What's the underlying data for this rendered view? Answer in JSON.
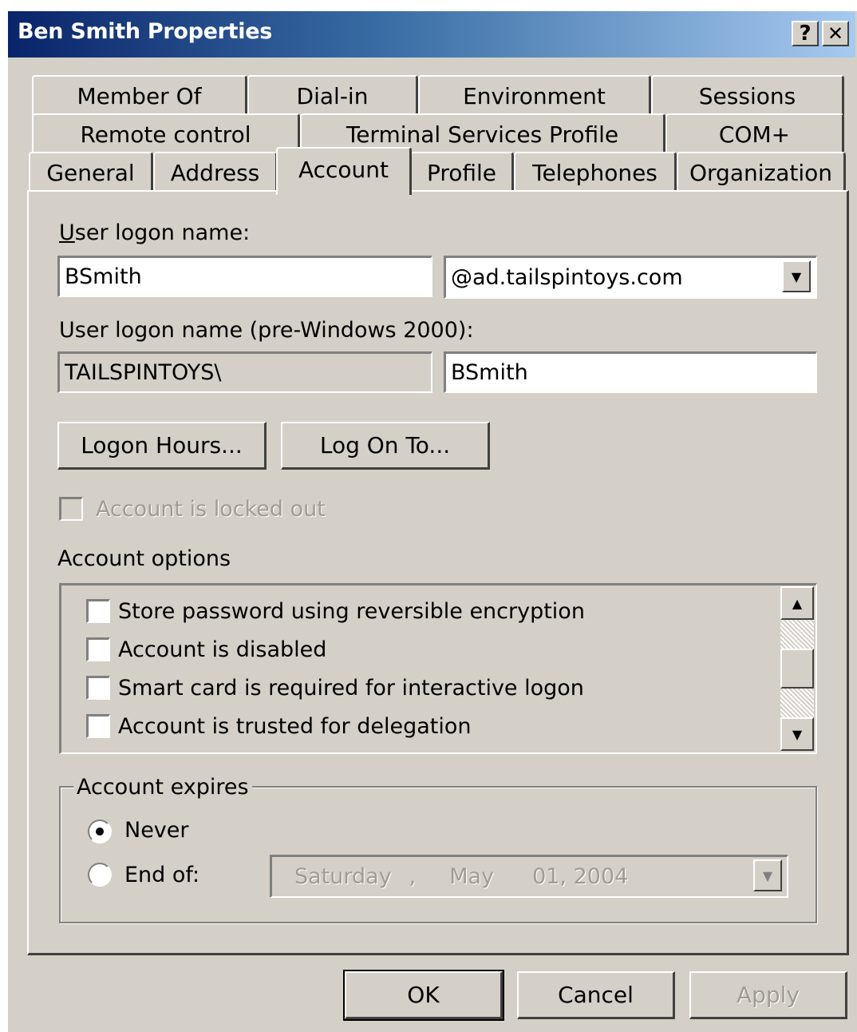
{
  "window": {
    "title": "Ben Smith Properties",
    "help_label": "?",
    "close_label": "✕"
  },
  "tabs": {
    "row1": [
      "Member Of",
      "Dial-in",
      "Environment",
      "Sessions"
    ],
    "row2": [
      "Remote control",
      "Terminal Services Profile",
      "COM+"
    ],
    "row3": [
      "General",
      "Address",
      "Account",
      "Profile",
      "Telephones",
      "Organization"
    ],
    "active": "Account"
  },
  "account": {
    "logon_label": "User logon name:",
    "logon_value": "BSmith",
    "domain_value": "@ad.tailspintoys.com",
    "pre2000_label": "User logon name (pre-Windows 2000):",
    "pre2000_domain": "TAILSPINTOYS\\",
    "pre2000_user": "BSmith",
    "logon_hours_button": "Logon Hours...",
    "log_on_to_button": "Log On To...",
    "locked_out_label": "Account is locked out",
    "options_label": "Account options",
    "options": [
      {
        "label": "Store password using reversible encryption",
        "checked": false
      },
      {
        "label": "Account is disabled",
        "checked": false
      },
      {
        "label": "Smart card is required for interactive logon",
        "checked": false
      },
      {
        "label": "Account is trusted for delegation",
        "checked": false
      }
    ],
    "expires_label": "Account expires",
    "never_label": "Never",
    "end_of_label": "End of:",
    "selected_expiry": "Never",
    "date_day": "Saturday",
    "date_sep": ",",
    "date_month": "May",
    "date_rest": "01, 2004"
  },
  "footer": {
    "ok": "OK",
    "cancel": "Cancel",
    "apply": "Apply"
  },
  "colors": {
    "face": "#d4d0c8",
    "title_start": "#0a246a",
    "title_end": "#a6caf0"
  }
}
